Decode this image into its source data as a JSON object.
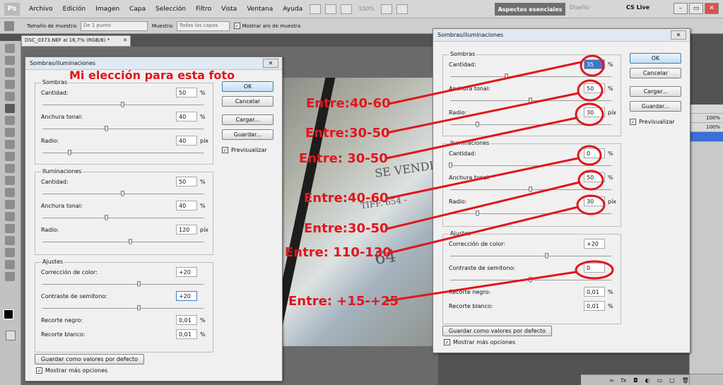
{
  "menubar": {
    "logo": "Ps",
    "items": [
      "Archivo",
      "Edición",
      "Imagen",
      "Capa",
      "Selección",
      "Filtro",
      "Vista",
      "Ventana",
      "Ayuda"
    ],
    "zoom": "100%",
    "workspace_active": "Aspectos esenciales",
    "workspace_other": "Diseño",
    "cs_live": "CS Live"
  },
  "optionsbar": {
    "sample_size_label": "Tamaño de muestra:",
    "sample_size_value": "De 1 punto",
    "sample_label": "Muestra:",
    "sample_value": "Todas las capas",
    "ring_label": "Mostrar aro de muestra"
  },
  "document": {
    "tab": "DSC_0373.NEF al 16,7% (RGB/8) *",
    "photo_text": [
      "SE VENDE",
      "TIFF. 654 -",
      "64"
    ]
  },
  "right_panel": {
    "zoom1": "100%",
    "zoom2": "100%"
  },
  "dialog_left": {
    "title": "Sombras/iluminaciones",
    "sombras": {
      "legend": "Sombras",
      "rows": [
        {
          "label": "Cantidad:",
          "value": "50",
          "unit": "%",
          "level": 0.5
        },
        {
          "label": "Anchura tonal:",
          "value": "40",
          "unit": "%",
          "level": 0.4
        },
        {
          "label": "Radio:",
          "value": "40",
          "unit": "píx",
          "level": 0.17
        }
      ]
    },
    "iluminaciones": {
      "legend": "Iluminaciones",
      "rows": [
        {
          "label": "Cantidad:",
          "value": "50",
          "unit": "%",
          "level": 0.5
        },
        {
          "label": "Anchura tonal:",
          "value": "40",
          "unit": "%",
          "level": 0.4
        },
        {
          "label": "Radio:",
          "value": "120",
          "unit": "píx",
          "level": 0.55
        }
      ]
    },
    "ajustes": {
      "legend": "Ajustes",
      "rows": [
        {
          "label": "Corrección de color:",
          "value": "+20",
          "unit": "",
          "level": 0.6
        },
        {
          "label": "Contraste de semitono:",
          "value": "+20",
          "unit": "",
          "level": 0.6
        },
        {
          "label": "Recorte negro:",
          "value": "0,01",
          "unit": "%"
        },
        {
          "label": "Recorte blanco:",
          "value": "0,01",
          "unit": "%"
        }
      ]
    },
    "buttons": {
      "ok": "OK",
      "cancel": "Cancelar",
      "load": "Cargar...",
      "save": "Guardar..."
    },
    "preview_label": "Previsualizar",
    "save_default": "Guardar como valores por defecto",
    "more_options": "Mostrar más opciones"
  },
  "dialog_right": {
    "title": "Sombras/iluminaciones",
    "sombras": {
      "legend": "Sombras",
      "rows": [
        {
          "label": "Cantidad:",
          "value": "35",
          "unit": "%",
          "level": 0.35
        },
        {
          "label": "Anchura tonal:",
          "value": "50",
          "unit": "%",
          "level": 0.5
        },
        {
          "label": "Radio:",
          "value": "30",
          "unit": "píx",
          "level": 0.17
        }
      ]
    },
    "iluminaciones": {
      "legend": "Iluminaciones",
      "rows": [
        {
          "label": "Cantidad:",
          "value": "0",
          "unit": "%",
          "level": 0.0
        },
        {
          "label": "Anchura tonal:",
          "value": "50",
          "unit": "%",
          "level": 0.5
        },
        {
          "label": "Radio:",
          "value": "30",
          "unit": "píx",
          "level": 0.17
        }
      ]
    },
    "ajustes": {
      "legend": "Ajustes",
      "rows": [
        {
          "label": "Corrección de color:",
          "value": "+20",
          "unit": "",
          "level": 0.6
        },
        {
          "label": "Contraste de semitono:",
          "value": "0",
          "unit": "",
          "level": 0.5
        },
        {
          "label": "Recorte negro:",
          "value": "0,01",
          "unit": "%"
        },
        {
          "label": "Recorte blanco:",
          "value": "0,01",
          "unit": "%"
        }
      ]
    },
    "buttons": {
      "ok": "OK",
      "cancel": "Cancelar",
      "load": "Cargar...",
      "save": "Guardar..."
    },
    "preview_label": "Previsualizar",
    "save_default": "Guardar como valores por defecto",
    "more_options": "Mostrar más opciones"
  },
  "annotations": {
    "headline": "Mi elección para esta foto",
    "ranges": [
      "Entre:40-60",
      "Entre:30-50",
      "Entre: 30-50",
      "Entre:40-60",
      "Entre:30-50",
      "Entre: 110-130",
      "Entre: +15-+25"
    ],
    "color": "#e0161c"
  }
}
